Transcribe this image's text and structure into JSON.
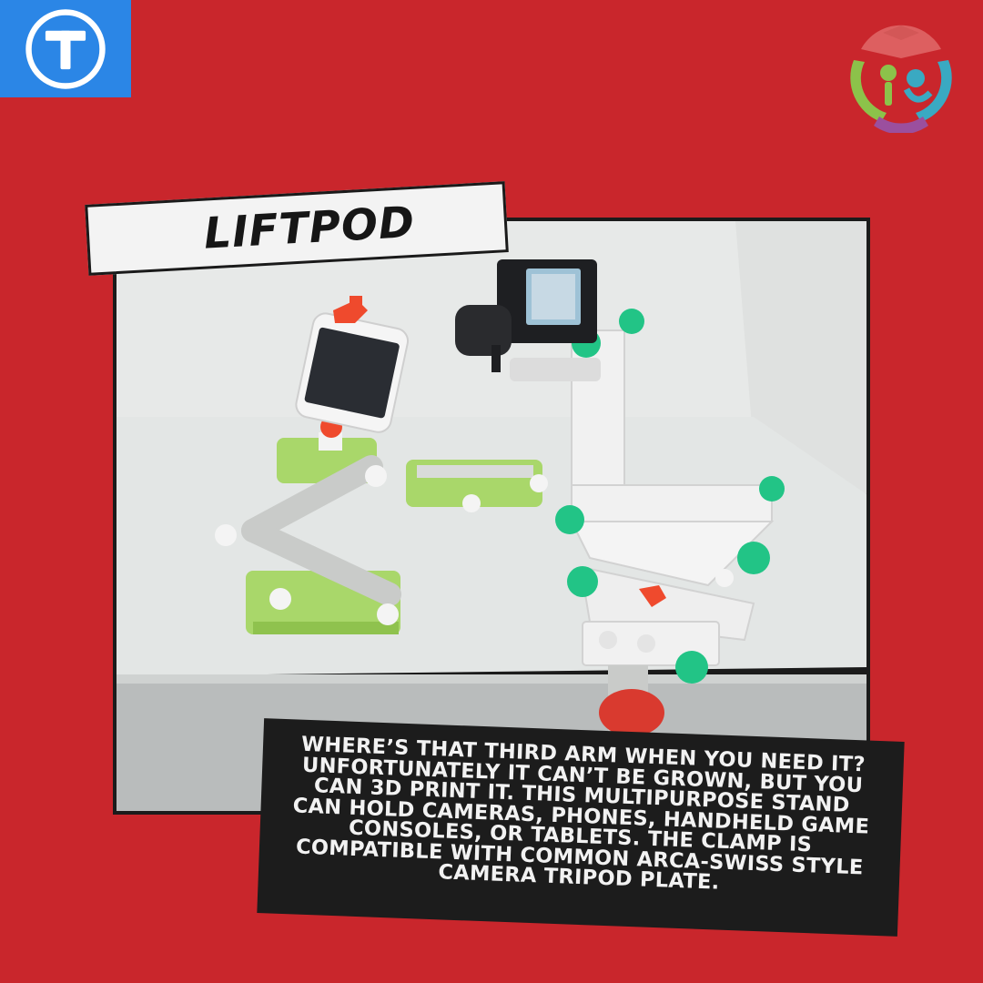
{
  "title": "LIFTPOD",
  "caption": "Where’s that third arm when you need it? Unfortunately it can’t be grown, but you can 3D print it. This multipurpose stand can hold cameras, phones, handheld game consoles, or tablets. The clamp is compatible with common Arca-Swiss style camera tripod plate.",
  "colors": {
    "background": "#c9262c",
    "badge": "#2b86e6",
    "caption_bg": "#1c1c1c",
    "title_bg": "#f3f3f3"
  },
  "icons": {
    "badge": "circle-t-icon",
    "org_logo": "people-globe-logo"
  }
}
